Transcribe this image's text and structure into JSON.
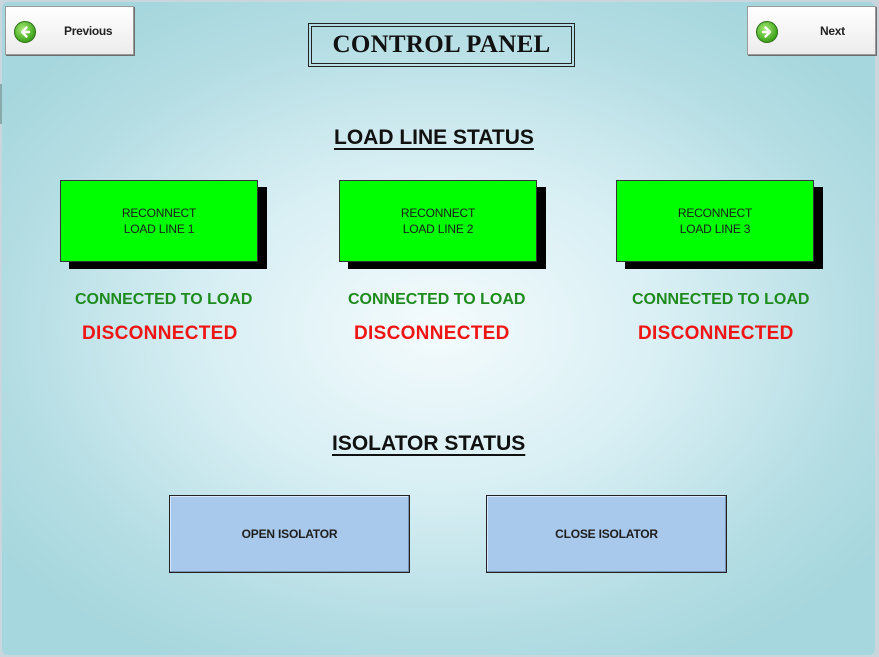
{
  "nav": {
    "previous_label": "Previous",
    "next_label": "Next",
    "previous_icon": "arrow-left-icon",
    "next_icon": "arrow-right-icon"
  },
  "title": "CONTROL PANEL",
  "load_line_status": {
    "heading": "LOAD LINE STATUS",
    "lines": [
      {
        "button_label": "RECONNECT\nLOAD LINE 1",
        "connected_text": "CONNECTED TO LOAD",
        "disconnected_text": "DISCONNECTED"
      },
      {
        "button_label": "RECONNECT\nLOAD LINE 2",
        "connected_text": "CONNECTED TO LOAD",
        "disconnected_text": "DISCONNECTED"
      },
      {
        "button_label": "RECONNECT\nLOAD LINE 3",
        "connected_text": "CONNECTED TO LOAD",
        "disconnected_text": "DISCONNECTED"
      }
    ]
  },
  "isolator_status": {
    "heading": "ISOLATOR STATUS",
    "open_label": "OPEN ISOLATOR",
    "close_label": "CLOSE ISOLATOR"
  },
  "colors": {
    "reconnect_button": "#00ff00",
    "connected_text": "#1f8b1f",
    "disconnected_text": "#f01515",
    "isolator_button": "#a9c9ec",
    "nav_icon": "#3fa51c"
  }
}
